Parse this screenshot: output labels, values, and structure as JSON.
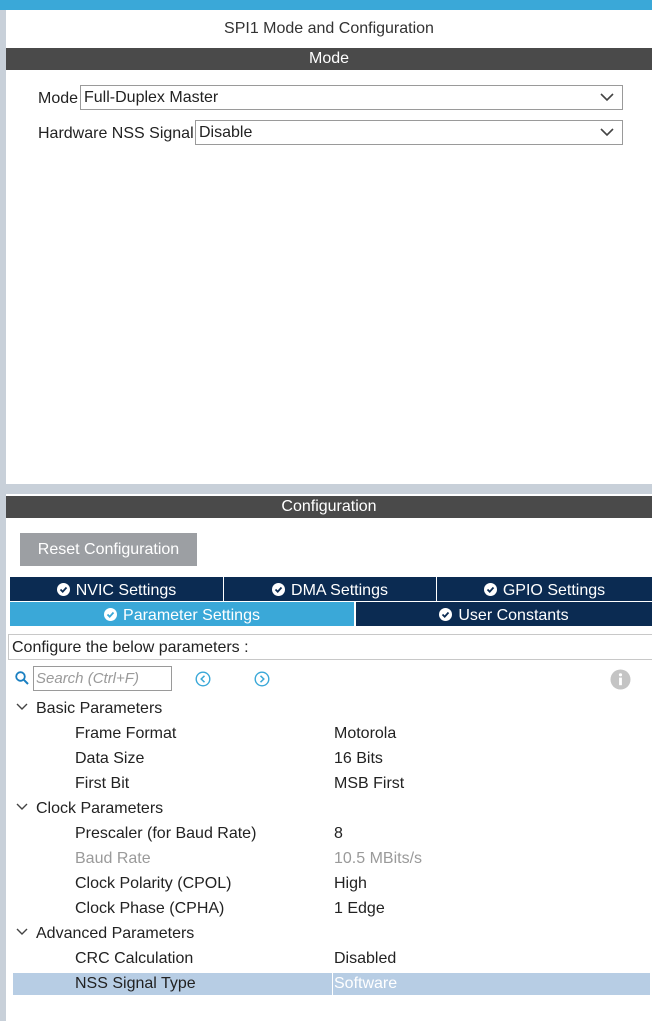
{
  "window": {
    "title": "SPI1 Mode and Configuration"
  },
  "mode_section": {
    "header": "Mode",
    "mode": {
      "label": "Mode",
      "value": "Full-Duplex Master"
    },
    "nss": {
      "label": "Hardware NSS Signal",
      "value": "Disable"
    }
  },
  "config_section": {
    "header": "Configuration",
    "reset_label": "Reset Configuration",
    "tabs": [
      {
        "label": "NVIC Settings",
        "active": false
      },
      {
        "label": "DMA Settings",
        "active": false
      },
      {
        "label": "GPIO Settings",
        "active": false
      },
      {
        "label": "Parameter Settings",
        "active": true
      },
      {
        "label": "User Constants",
        "active": false
      }
    ],
    "hint": "Configure the below parameters :",
    "search_placeholder": "Search (Ctrl+F)",
    "groups": [
      {
        "name": "Basic Parameters",
        "params": [
          {
            "name": "Frame Format",
            "value": "Motorola"
          },
          {
            "name": "Data Size",
            "value": "16 Bits"
          },
          {
            "name": "First Bit",
            "value": "MSB First"
          }
        ]
      },
      {
        "name": "Clock Parameters",
        "params": [
          {
            "name": "Prescaler (for Baud Rate)",
            "value": "8"
          },
          {
            "name": "Baud Rate",
            "value": "10.5 MBits/s"
          },
          {
            "name": "Clock Polarity (CPOL)",
            "value": "High"
          },
          {
            "name": "Clock Phase (CPHA)",
            "value": "1 Edge"
          }
        ]
      },
      {
        "name": "Advanced Parameters",
        "params": [
          {
            "name": "CRC Calculation",
            "value": "Disabled"
          },
          {
            "name": "NSS Signal Type",
            "value": "Software"
          }
        ]
      }
    ]
  },
  "colors": {
    "accent": "#3aa8d8",
    "tab_dark": "#0b2b52",
    "header_bar": "#4a4a4a",
    "selected_row": "#b7cde4",
    "button_gray": "#9c9fa3"
  },
  "icons": [
    "chevron-down-icon",
    "check-circle-icon",
    "search-icon",
    "nav-prev-icon",
    "nav-next-icon",
    "info-icon"
  ]
}
